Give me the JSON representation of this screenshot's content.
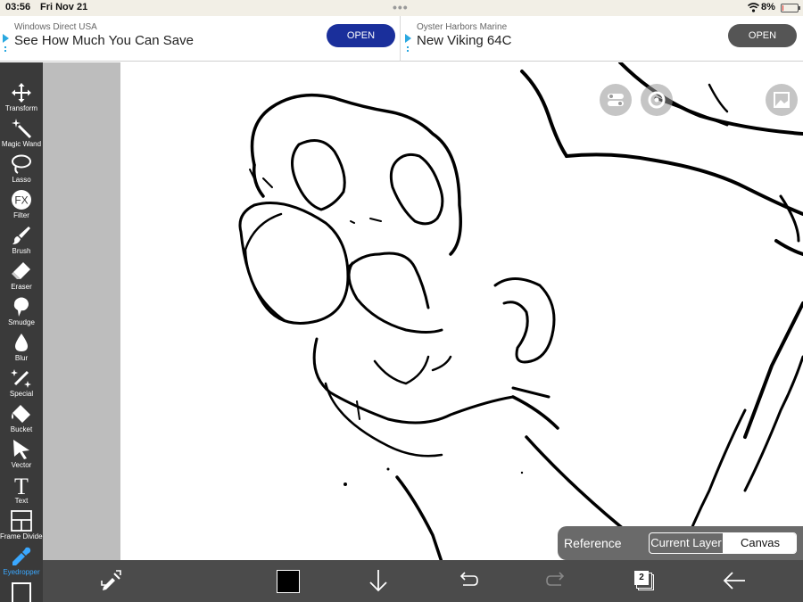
{
  "status_bar": {
    "time": "03:56",
    "date": "Fri Nov 21",
    "battery_percent": "8%",
    "battery_level": 0.08
  },
  "ads": [
    {
      "advertiser": "Windows Direct USA",
      "headline": "See How Much You Can Save",
      "button": "OPEN"
    },
    {
      "advertiser": "Oyster Harbors Marine",
      "headline": "New Viking 64C",
      "button": "OPEN"
    }
  ],
  "toolbar": {
    "tools": [
      {
        "label": "Transform",
        "icon": "move-arrows-icon"
      },
      {
        "label": "Magic Wand",
        "icon": "magic-wand-icon"
      },
      {
        "label": "Lasso",
        "icon": "lasso-icon"
      },
      {
        "label": "Filter",
        "icon": "fx-icon",
        "glyph": "FX"
      },
      {
        "label": "Brush",
        "icon": "brush-icon"
      },
      {
        "label": "Eraser",
        "icon": "eraser-icon"
      },
      {
        "label": "Smudge",
        "icon": "smudge-icon"
      },
      {
        "label": "Blur",
        "icon": "drop-icon"
      },
      {
        "label": "Special",
        "icon": "sparkle-pen-icon"
      },
      {
        "label": "Bucket",
        "icon": "bucket-icon"
      },
      {
        "label": "Vector",
        "icon": "cursor-arrow-icon"
      },
      {
        "label": "Text",
        "icon": "text-icon",
        "glyph": "T"
      },
      {
        "label": "Frame Divider",
        "icon": "frame-divider-icon"
      },
      {
        "label": "Eyedropper",
        "icon": "eyedropper-icon",
        "active": true
      }
    ],
    "active_color": "#3aa8ff"
  },
  "reference": {
    "label": "Reference",
    "options": [
      "Current Layer",
      "Canvas"
    ],
    "selected": "Canvas"
  },
  "bottom_bar": {
    "primary_color": "#000000",
    "layer_count": "2"
  },
  "floating_buttons": [
    "toggle-icon",
    "settings-icon",
    "reference-image-icon"
  ]
}
